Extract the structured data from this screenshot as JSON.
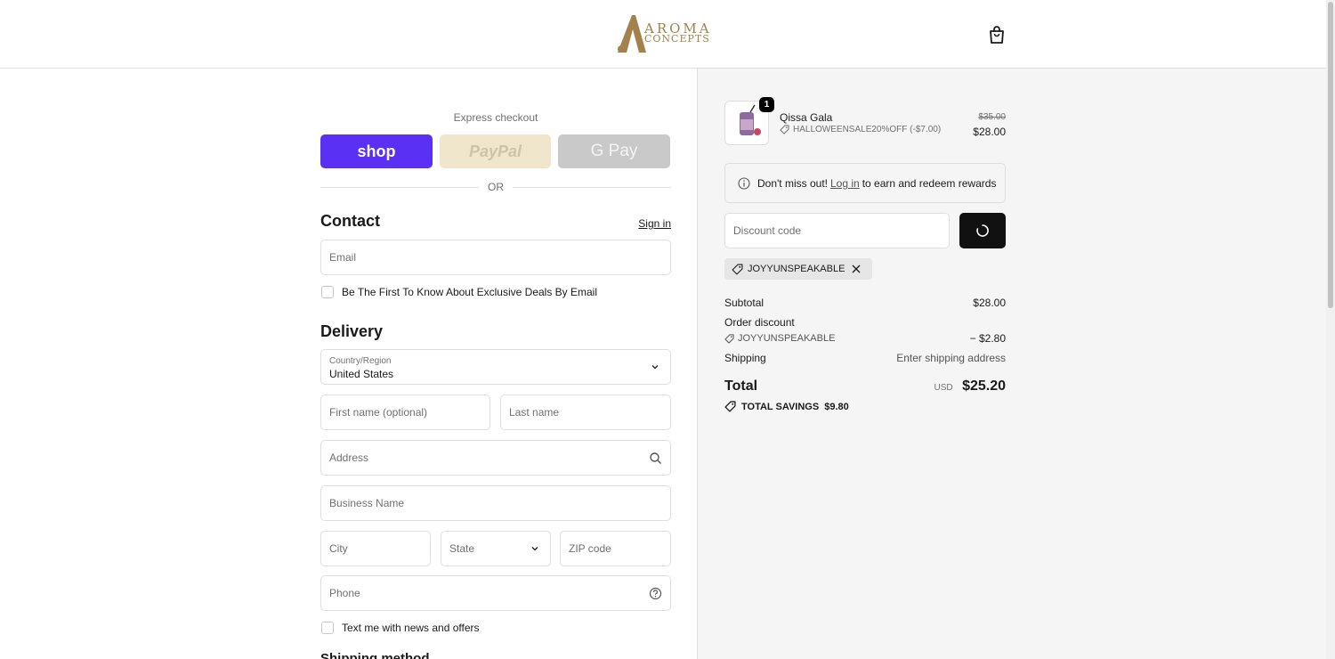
{
  "header": {
    "logo_line1": "AROMA",
    "logo_line2": "CONCEPTS"
  },
  "express": {
    "title": "Express checkout",
    "shop_label": "shop",
    "paypal_label": "PayPal",
    "gpay_label": "G Pay",
    "or_label": "OR"
  },
  "contact": {
    "heading": "Contact",
    "signin_label": "Sign in",
    "email_placeholder": "Email",
    "newsletter_label": "Be The First To Know About Exclusive Deals By Email"
  },
  "delivery": {
    "heading": "Delivery",
    "country_label": "Country/Region",
    "country_value": "United States",
    "first_name_placeholder": "First name (optional)",
    "last_name_placeholder": "Last name",
    "address_placeholder": "Address",
    "business_placeholder": "Business Name",
    "city_placeholder": "City",
    "state_placeholder": "State",
    "zip_placeholder": "ZIP code",
    "phone_placeholder": "Phone",
    "sms_label": "Text me with news and offers",
    "next_heading": "Shipping method"
  },
  "summary": {
    "product": {
      "name": "Qissa Gala",
      "quantity": "1",
      "discount_line": "HALLOWEENSALE20%OFF (-$7.00)",
      "price_old": "$35.00",
      "price_new": "$28.00"
    },
    "rewards": {
      "prefix": "Don't miss out!",
      "link": "Log in",
      "suffix": "to earn and redeem rewards"
    },
    "discount_placeholder": "Discount code",
    "applied_code": "JOYYUNSPEAKABLE",
    "subtotal_label": "Subtotal",
    "subtotal_value": "$28.00",
    "order_discount_label": "Order discount",
    "order_discount_code": "JOYYUNSPEAKABLE",
    "order_discount_value": "− $2.80",
    "shipping_label": "Shipping",
    "shipping_value": "Enter shipping address",
    "total_label": "Total",
    "currency": "USD",
    "total_value": "$25.20",
    "savings_label": "TOTAL SAVINGS",
    "savings_value": "$9.80"
  },
  "colors": {
    "shop_purple": "#5a31f4",
    "brand_gold": "#a2824a",
    "apply_button": "#111111"
  }
}
